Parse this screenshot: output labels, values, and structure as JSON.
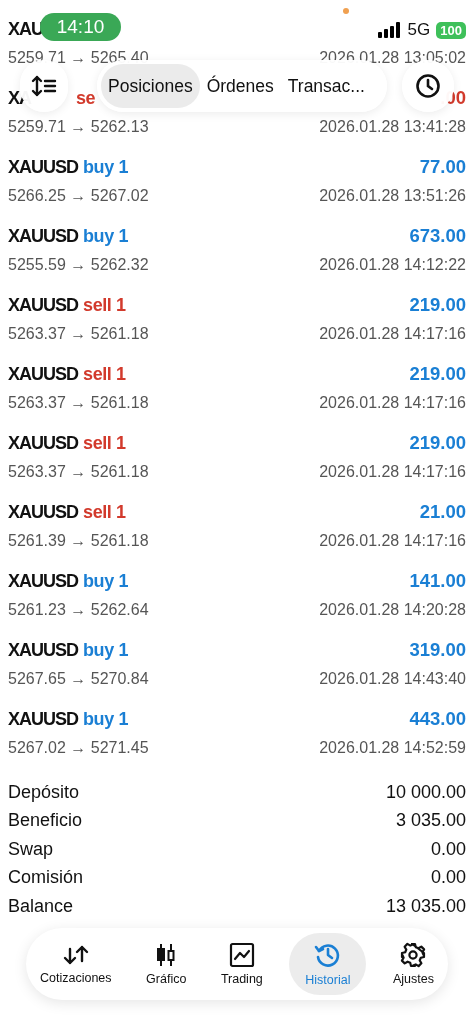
{
  "status_bar": {
    "time": "14:10",
    "network": "5G",
    "battery": "100"
  },
  "header": {
    "tabs": [
      {
        "label": "Posiciones",
        "selected": true
      },
      {
        "label": "Órdenes",
        "selected": false
      },
      {
        "label": "Transac...",
        "selected": false
      }
    ]
  },
  "trades": [
    {
      "symbol": "XAU",
      "prices": "5259.71 → 5265.40",
      "time": "2026.01.28 13:05:02"
    },
    {
      "symbol": "XA",
      "side": "se",
      "kind": "sell",
      "profit": ".00",
      "loss": true,
      "prices": "5259.71 → 5262.13",
      "time": "2026.01.28 13:41:28"
    },
    {
      "symbol": "XAUUSD",
      "side": "buy 1",
      "kind": "buy",
      "profit": "77.00",
      "loss": false,
      "prices": "5266.25 → 5267.02",
      "time": "2026.01.28 13:51:26"
    },
    {
      "symbol": "XAUUSD",
      "side": "buy 1",
      "kind": "buy",
      "profit": "673.00",
      "loss": false,
      "prices": "5255.59 → 5262.32",
      "time": "2026.01.28 14:12:22"
    },
    {
      "symbol": "XAUUSD",
      "side": "sell 1",
      "kind": "sell",
      "profit": "219.00",
      "loss": false,
      "prices": "5263.37 → 5261.18",
      "time": "2026.01.28 14:17:16"
    },
    {
      "symbol": "XAUUSD",
      "side": "sell 1",
      "kind": "sell",
      "profit": "219.00",
      "loss": false,
      "prices": "5263.37 → 5261.18",
      "time": "2026.01.28 14:17:16"
    },
    {
      "symbol": "XAUUSD",
      "side": "sell 1",
      "kind": "sell",
      "profit": "219.00",
      "loss": false,
      "prices": "5263.37 → 5261.18",
      "time": "2026.01.28 14:17:16"
    },
    {
      "symbol": "XAUUSD",
      "side": "sell 1",
      "kind": "sell",
      "profit": "21.00",
      "loss": false,
      "prices": "5261.39 → 5261.18",
      "time": "2026.01.28 14:17:16"
    },
    {
      "symbol": "XAUUSD",
      "side": "buy 1",
      "kind": "buy",
      "profit": "141.00",
      "loss": false,
      "prices": "5261.23 → 5262.64",
      "time": "2026.01.28 14:20:28"
    },
    {
      "symbol": "XAUUSD",
      "side": "buy 1",
      "kind": "buy",
      "profit": "319.00",
      "loss": false,
      "prices": "5267.65 → 5270.84",
      "time": "2026.01.28 14:43:40"
    },
    {
      "symbol": "XAUUSD",
      "side": "buy 1",
      "kind": "buy",
      "profit": "443.00",
      "loss": false,
      "prices": "5267.02 → 5271.45",
      "time": "2026.01.28 14:52:59"
    }
  ],
  "summary": [
    {
      "label": "Depósito",
      "value": "10 000.00"
    },
    {
      "label": "Beneficio",
      "value": "3 035.00"
    },
    {
      "label": "Swap",
      "value": "0.00"
    },
    {
      "label": "Comisión",
      "value": "0.00"
    },
    {
      "label": "Balance",
      "value": "13 035.00"
    }
  ],
  "bottom_nav": [
    {
      "label": "Cotizaciones",
      "kind": "quotes",
      "selected": false
    },
    {
      "label": "Gráfico",
      "kind": "chart",
      "selected": false
    },
    {
      "label": "Trading",
      "kind": "trading",
      "selected": false
    },
    {
      "label": "Historial",
      "kind": "history",
      "selected": true
    },
    {
      "label": "Ajustes",
      "kind": "settings",
      "selected": false
    }
  ]
}
